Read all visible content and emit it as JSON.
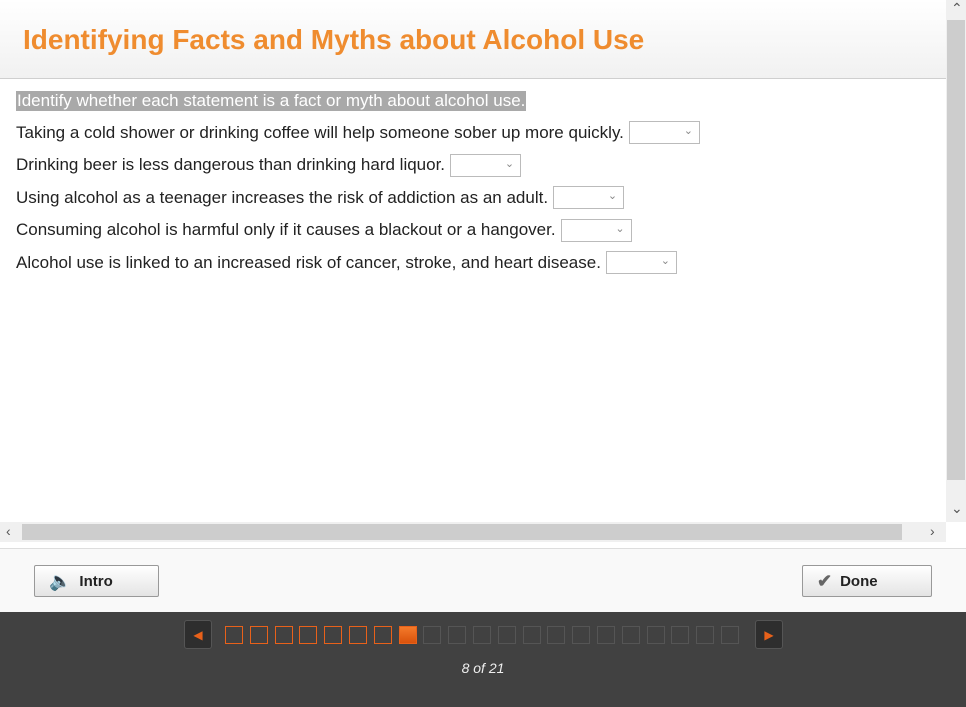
{
  "title": "Identifying Facts and Myths about Alcohol Use",
  "instruction": "Identify whether each statement is a fact or myth about alcohol use.",
  "statements": [
    {
      "text": "Taking a cold shower or drinking coffee will help someone sober up more quickly.",
      "value": ""
    },
    {
      "text": "Drinking beer is less dangerous than drinking hard liquor.",
      "value": ""
    },
    {
      "text": "Using alcohol as a teenager increases the risk of addiction as an adult.",
      "value": ""
    },
    {
      "text": "Consuming alcohol is harmful only if it causes a blackout or a hangover.",
      "value": ""
    },
    {
      "text": "Alcohol use is linked to an increased risk of cancer, stroke, and heart disease.",
      "value": ""
    }
  ],
  "footer": {
    "intro_label": "Intro",
    "done_label": "Done"
  },
  "nav": {
    "current": 8,
    "total": 21,
    "page_label": "8 of 21"
  },
  "colors": {
    "accent": "#ef8c2f",
    "nav_bg": "#414141",
    "progress": "#e8611a"
  }
}
